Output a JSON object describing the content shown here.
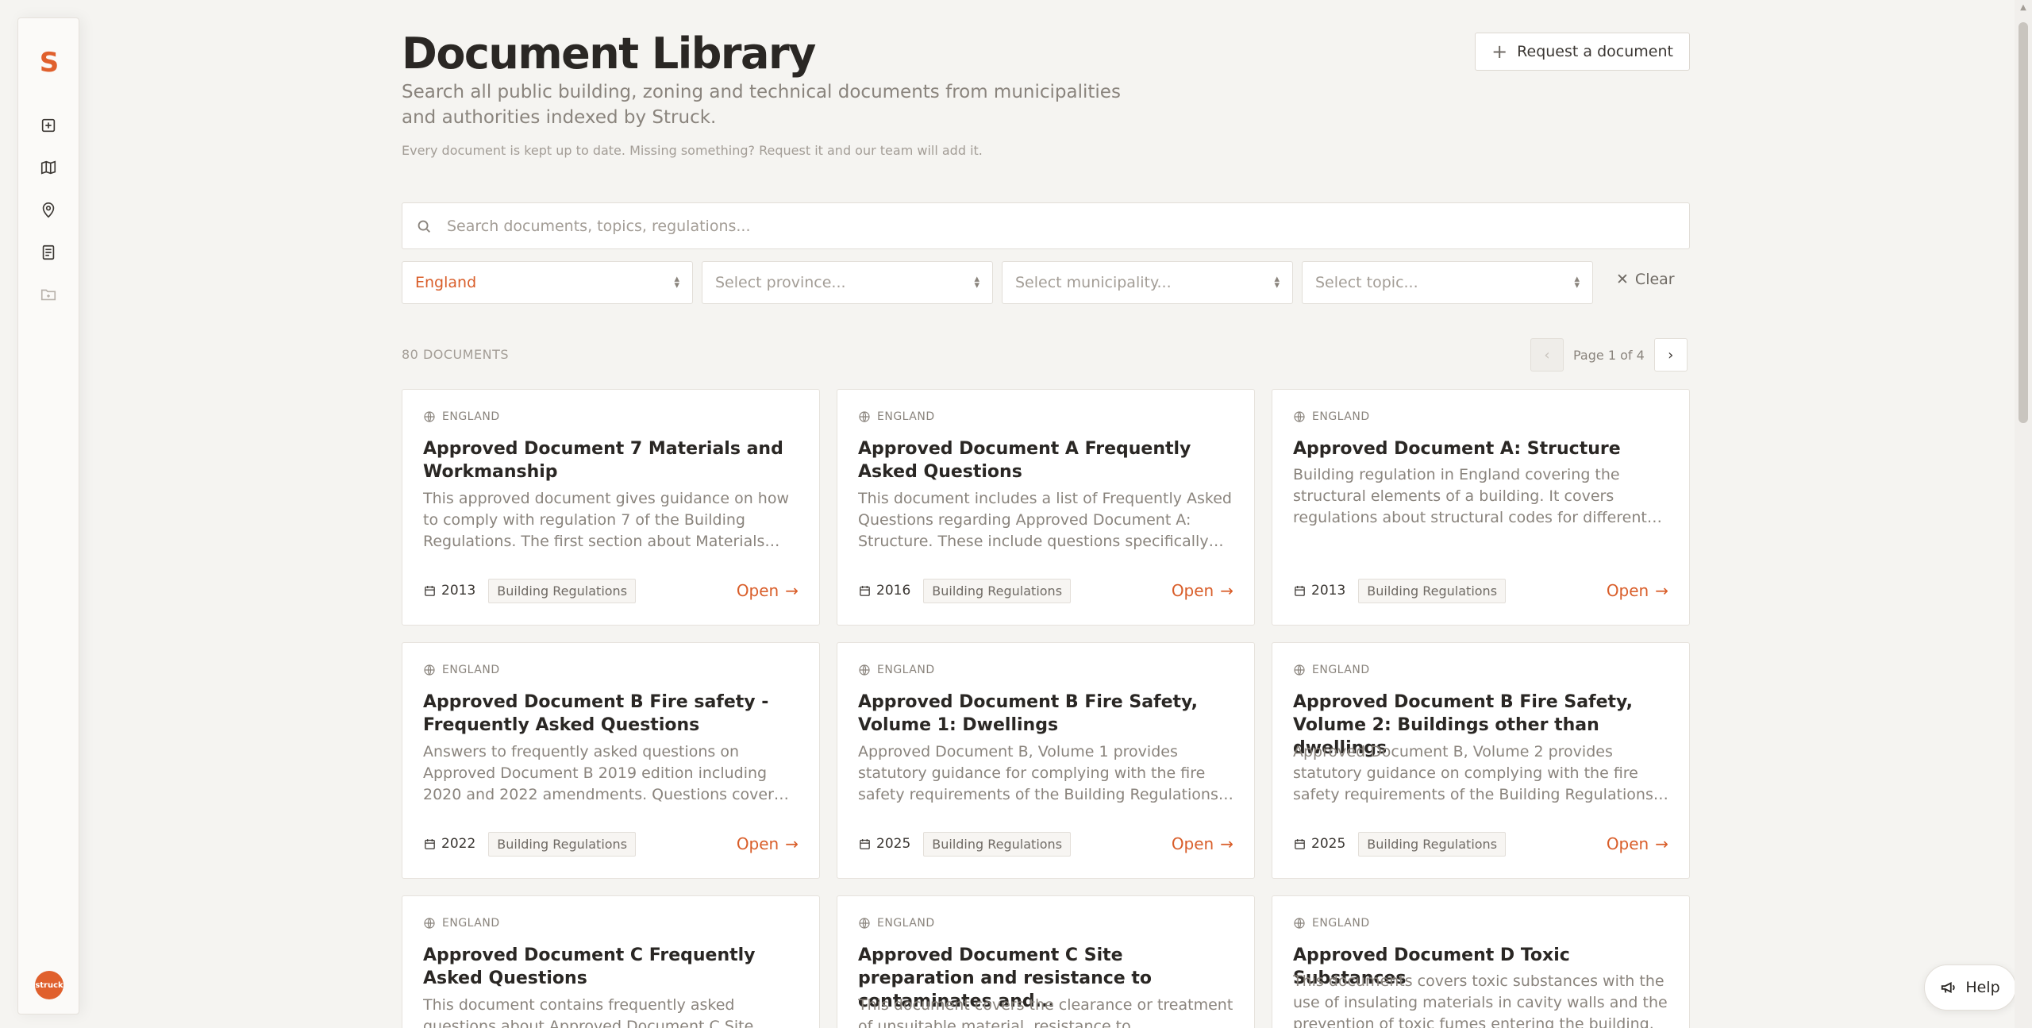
{
  "sidebar": {
    "logo": "S",
    "items": [
      {
        "icon": "add-document-icon"
      },
      {
        "icon": "map-icon"
      },
      {
        "icon": "location-pin-icon"
      },
      {
        "icon": "document-list-icon"
      },
      {
        "icon": "folder-icon"
      }
    ],
    "avatar": "struck"
  },
  "header": {
    "title": "Document Library",
    "subtitle": "Search all public building, zoning and technical documents from municipalities and authorities indexed by Struck.",
    "note": "Every document is kept up to date. Missing something? Request it and our team will add it.",
    "request_button": "Request a document"
  },
  "search": {
    "placeholder": "Search documents, topics, regulations..."
  },
  "filters": {
    "country": "England",
    "province": "Select province...",
    "municipality": "Select municipality...",
    "topic": "Select topic...",
    "clear": "Clear"
  },
  "results": {
    "count_label": "80 DOCUMENTS",
    "page_label": "Page 1 of 4"
  },
  "cards": [
    {
      "region": "ENGLAND",
      "title": "Approved Document 7 Materials and Workmanship",
      "desc": "This approved document gives guidance on how to comply with regulation 7 of the Building Regulations. The first section about Materials provides guidance.",
      "year": "2013",
      "tag": "Building Regulations",
      "open": "Open"
    },
    {
      "region": "ENGLAND",
      "title": "Approved Document A Frequently Asked Questions",
      "desc": "This document includes a list of Frequently Asked Questions regarding Approved Document A: Structure. These include questions specifically about structure.",
      "year": "2016",
      "tag": "Building Regulations",
      "open": "Open"
    },
    {
      "region": "ENGLAND",
      "title": "Approved Document A: Structure",
      "desc": "Building regulation in England covering the structural elements of a building. It covers regulations about structural codes for different building types.",
      "year": "2013",
      "tag": "Building Regulations",
      "open": "Open"
    },
    {
      "region": "ENGLAND",
      "title": "Approved Document B Fire safety - Frequently Asked Questions",
      "desc": "Answers to frequently asked questions on Approved Document B 2019 edition including 2020 and 2022 amendments. Questions cover aspects of fire safety.",
      "year": "2022",
      "tag": "Building Regulations",
      "open": "Open"
    },
    {
      "region": "ENGLAND",
      "title": "Approved Document B Fire Safety, Volume 1: Dwellings",
      "desc": "Approved Document B, Volume 1 provides statutory guidance for complying with the fire safety requirements of the Building Regulations for dwellings.",
      "year": "2025",
      "tag": "Building Regulations",
      "open": "Open"
    },
    {
      "region": "ENGLAND",
      "title": "Approved Document B Fire Safety, Volume 2: Buildings other than dwellings",
      "desc": "Approved Document B, Volume 2 provides statutory guidance on complying with the fire safety requirements of the Building Regulations for other buildings.",
      "year": "2025",
      "tag": "Building Regulations",
      "open": "Open"
    },
    {
      "region": "ENGLAND",
      "title": "Approved Document C Frequently Asked Questions",
      "desc": "This document contains frequently asked questions about Approved Document C Site preparation.",
      "year": "",
      "tag": "",
      "open": ""
    },
    {
      "region": "ENGLAND",
      "title": "Approved Document C Site preparation and resistance to contaminates and...",
      "desc": "This document covers the clearance or treatment of unsuitable material, resistance to contaminants.",
      "year": "",
      "tag": "",
      "open": ""
    },
    {
      "region": "ENGLAND",
      "title": "Approved Document D Toxic Substances",
      "desc": "This documents covers toxic substances with the use of insulating materials in cavity walls and the prevention of toxic fumes entering the building.",
      "year": "",
      "tag": "",
      "open": ""
    }
  ],
  "help": {
    "label": "Help"
  }
}
